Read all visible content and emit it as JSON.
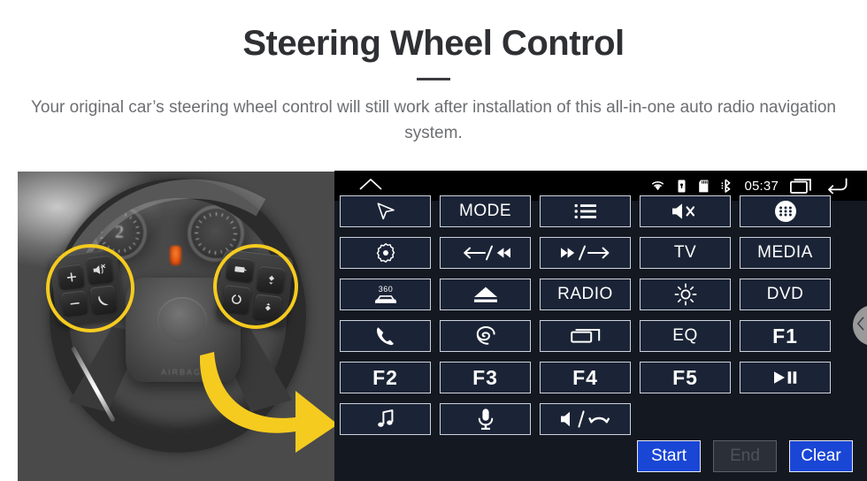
{
  "header": {
    "title": "Steering Wheel Control",
    "subtitle": "Your original car’s steering wheel control will still work after installation of this all-in-one auto radio navigation system."
  },
  "photo": {
    "alt": "Car steering wheel with left and right control clusters highlighted",
    "highlight_color": "#f5cb1f",
    "arrow_color": "#f5cb1f",
    "gauge_left_label": "2",
    "pad_text": "AIRBAG",
    "left_cluster_keys": [
      "+",
      "−",
      "mute-icon",
      "phone-icon"
    ],
    "right_cluster_keys": [
      "display-icon",
      "up-icon",
      "mode-icon",
      "down-icon"
    ]
  },
  "radio": {
    "statusbar": {
      "home_icon": "home-icon",
      "wifi_icon": "wifi-icon",
      "usb_icon": "usb-icon",
      "sdcard_icon": "sdcard-icon",
      "bluetooth_icon": "bluetooth-icon",
      "clock": "05:37",
      "recents_icon": "recents-icon",
      "back_icon": "back-icon"
    },
    "grid": {
      "rows": [
        [
          {
            "label": "",
            "icon": "navigation-arrow-icon"
          },
          {
            "label": "MODE",
            "icon": ""
          },
          {
            "label": "",
            "icon": "list-menu-icon"
          },
          {
            "label": "",
            "icon": "mute-icon"
          },
          {
            "label": "",
            "icon": "apps-grid-icon"
          }
        ],
        [
          {
            "label": "",
            "icon": "settings-gear-icon"
          },
          {
            "label": "",
            "icon": "previous-track-icon"
          },
          {
            "label": "",
            "icon": "next-track-icon"
          },
          {
            "label": "TV",
            "icon": ""
          },
          {
            "label": "MEDIA",
            "icon": ""
          }
        ],
        [
          {
            "label": "",
            "icon": "camera-360-icon"
          },
          {
            "label": "",
            "icon": "eject-icon"
          },
          {
            "label": "RADIO",
            "icon": ""
          },
          {
            "label": "",
            "icon": "brightness-icon"
          },
          {
            "label": "DVD",
            "icon": ""
          }
        ],
        [
          {
            "label": "",
            "icon": "phone-icon"
          },
          {
            "label": "",
            "icon": "voice-swirl-icon"
          },
          {
            "label": "",
            "icon": "window-switch-icon"
          },
          {
            "label": "EQ",
            "icon": ""
          },
          {
            "label": "F1",
            "icon": ""
          }
        ],
        [
          {
            "label": "F2",
            "icon": ""
          },
          {
            "label": "F3",
            "icon": ""
          },
          {
            "label": "F4",
            "icon": ""
          },
          {
            "label": "F5",
            "icon": ""
          },
          {
            "label": "",
            "icon": "play-pause-icon"
          }
        ],
        [
          {
            "label": "",
            "icon": "music-note-icon"
          },
          {
            "label": "",
            "icon": "microphone-icon"
          },
          {
            "label": "",
            "icon": "speaker-hangup-icon"
          },
          {
            "label": "",
            "icon": ""
          },
          {
            "label": "",
            "icon": ""
          }
        ]
      ]
    },
    "actions": {
      "start_label": "Start",
      "end_label": "End",
      "clear_label": "Clear",
      "accent_color": "#1a46d6",
      "disabled_color": "#2b2f38"
    },
    "drawer_icon": "chevron-left-icon"
  }
}
